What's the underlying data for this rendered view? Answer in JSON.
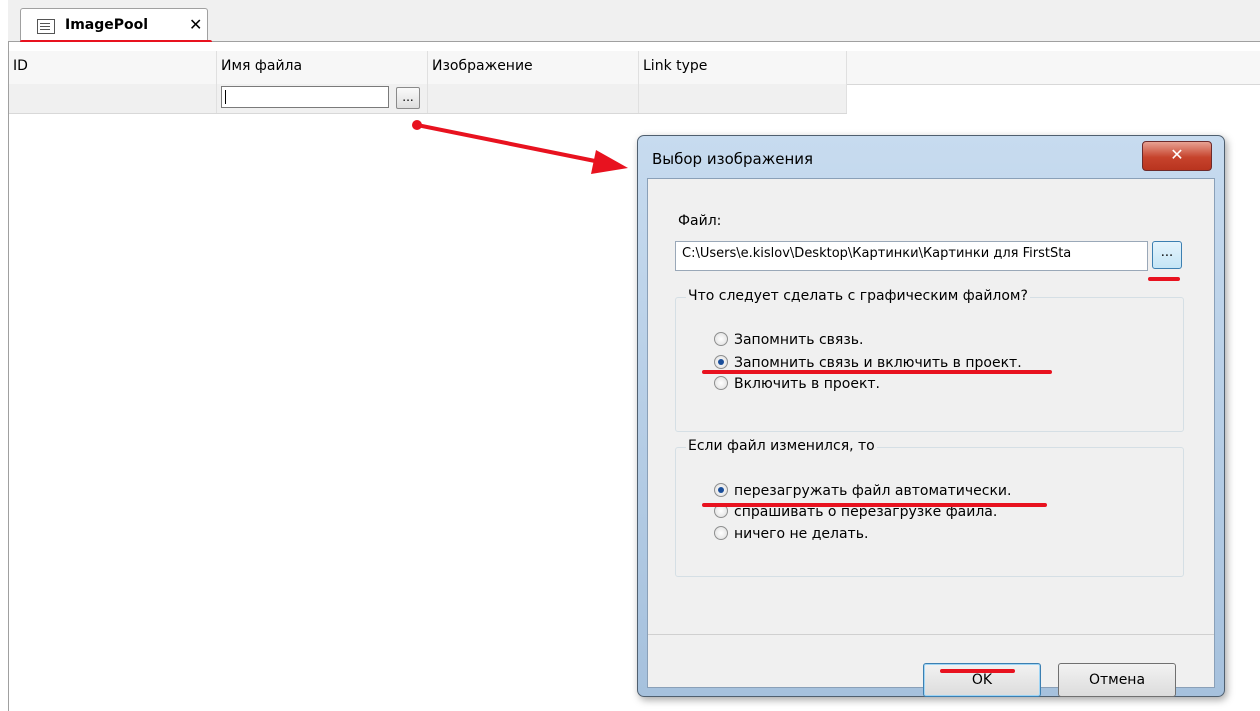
{
  "tab": {
    "title": "ImagePool",
    "close_glyph": "✕"
  },
  "grid": {
    "columns": [
      "ID",
      "Имя файла",
      "Изображение",
      "Link type"
    ],
    "row": {
      "filename_value": "",
      "browse_label": "..."
    }
  },
  "dialog": {
    "title": "Выбор изображения",
    "close_glyph": "✕",
    "file_label": "Файл:",
    "file_value": "C:\\Users\\e.kislov\\Desktop\\Картинки\\Картинки для FirstSta",
    "browse_label": "...",
    "group1": {
      "title": "Что следует сделать с графическим файлом?",
      "options": [
        {
          "label": "Запомнить связь.",
          "selected": false
        },
        {
          "label": "Запомнить связь и включить в проект.",
          "selected": true
        },
        {
          "label": "Включить в проект.",
          "selected": false
        }
      ]
    },
    "group2": {
      "title": "Если файл изменился, то",
      "options": [
        {
          "label": "перезагружать файл автоматически.",
          "selected": true
        },
        {
          "label": "спрашивать о перезагрузке файла.",
          "selected": false
        },
        {
          "label": "ничего не делать.",
          "selected": false
        }
      ]
    },
    "ok_label": "OK",
    "cancel_label": "Отмена"
  },
  "colors": {
    "annotation": "#e8121f",
    "title_bar": "#a6c1dd",
    "close_button": "#c6432c"
  }
}
